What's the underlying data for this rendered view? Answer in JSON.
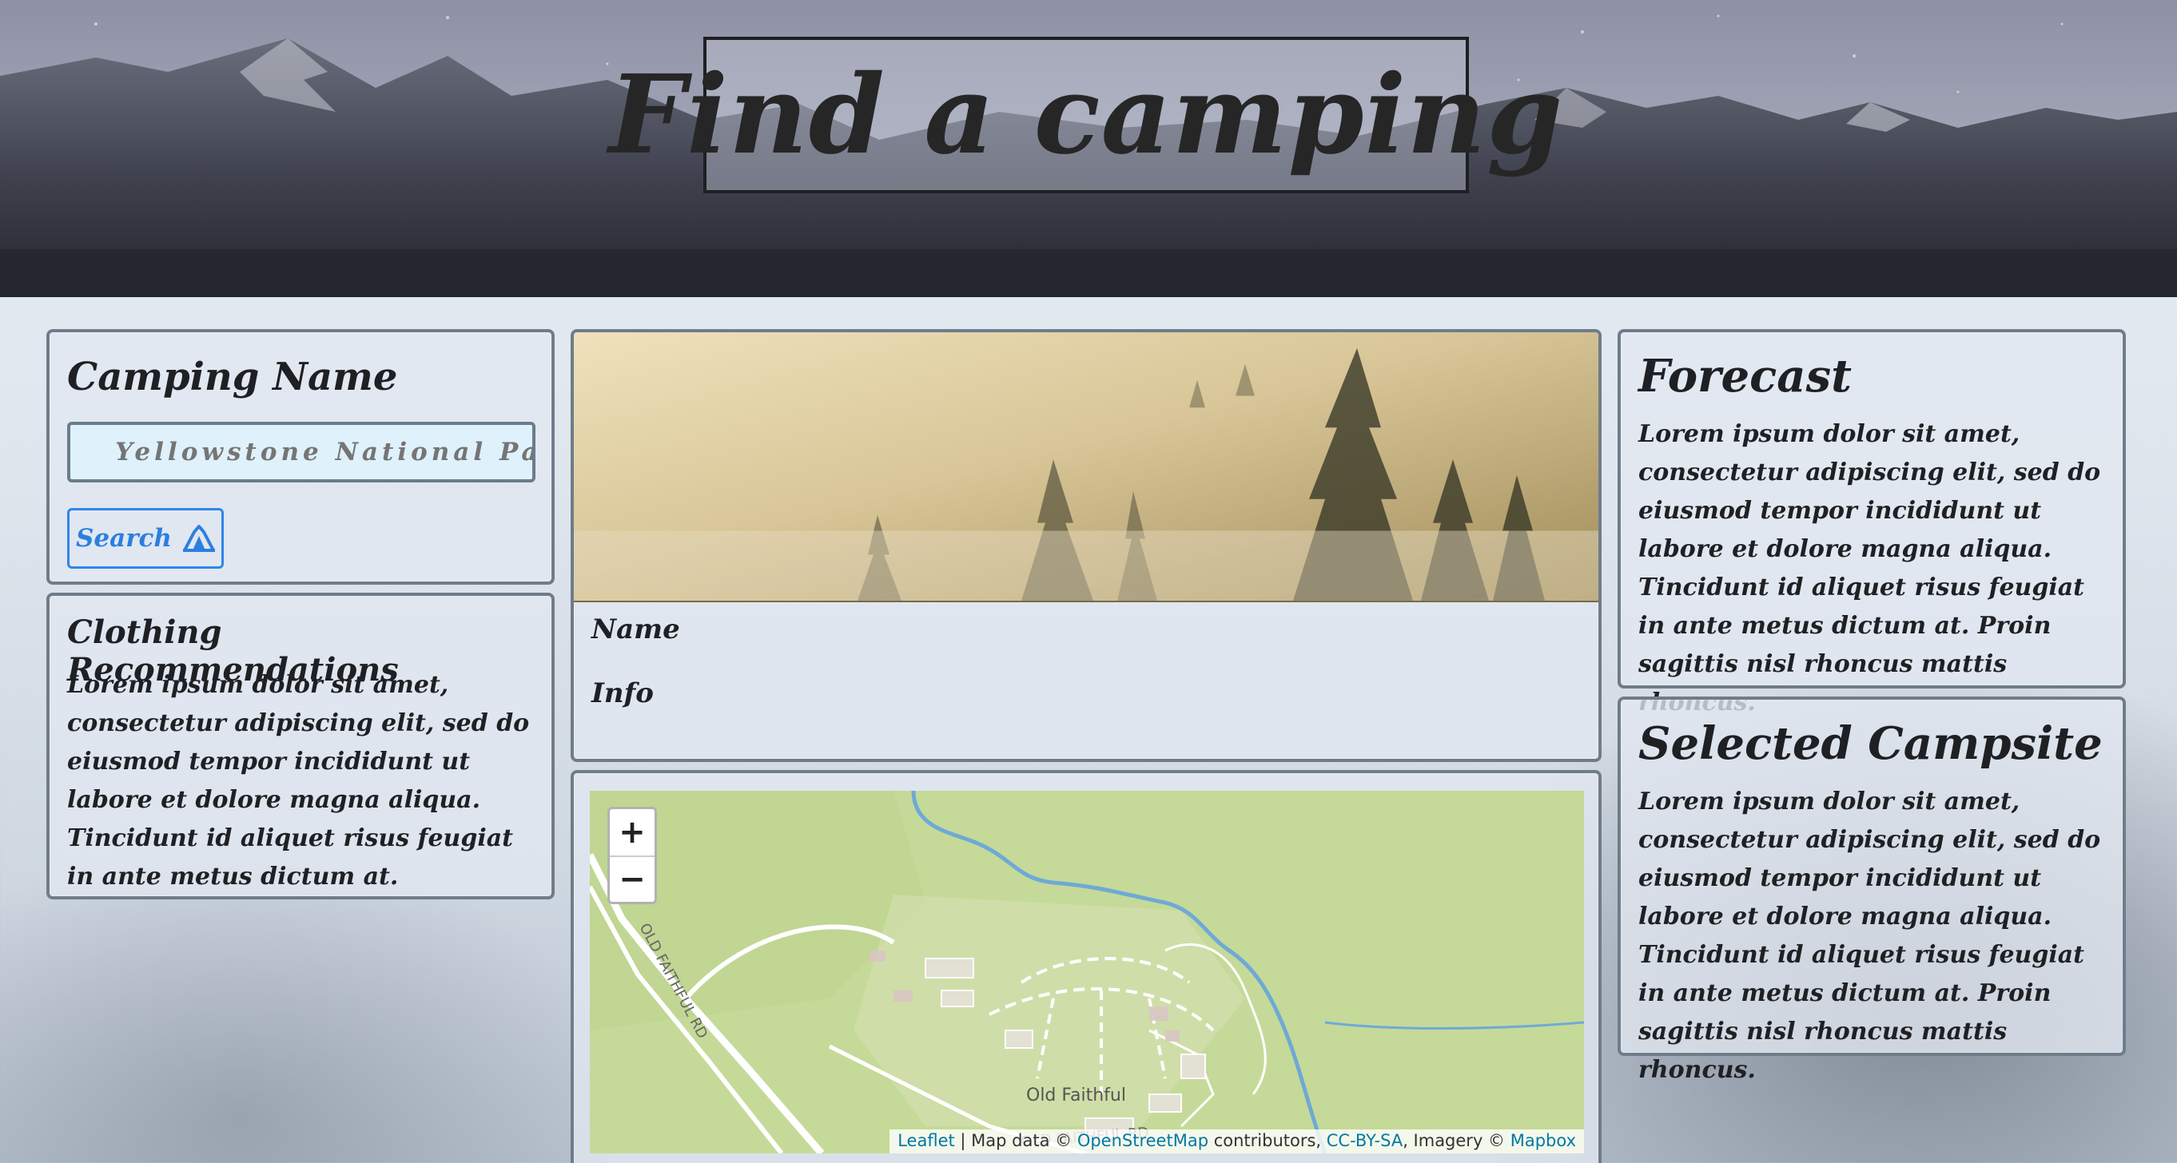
{
  "header": {
    "title": "Find a camping"
  },
  "search": {
    "heading": "Camping Name",
    "placeholder": "Yellowstone National Park",
    "button_label": "Search",
    "button_icon": "tent-icon",
    "accent_color": "#2b7fe0"
  },
  "clothing": {
    "heading": "Clothing Recommendations",
    "text": "Lorem ipsum dolor sit amet, consectetur adipiscing elit, sed do eiusmod tempor incididunt ut labore et dolore magna aliqua. Tincidunt id aliquet risus feugiat in ante metus dictum at."
  },
  "detail": {
    "name_label": "Name",
    "info_label": "Info"
  },
  "map": {
    "zoom_in": "+",
    "zoom_out": "−",
    "labels": {
      "road_1": "OLD FAITHFUL RD",
      "road_2": "OLD FAITHFUL RD",
      "place": "Old Faithful"
    },
    "attribution": {
      "leaflet": "Leaflet",
      "sep1": " | Map data © ",
      "osm": "OpenStreetMap",
      "sep2": " contributors, ",
      "license": "CC-BY-SA",
      "sep3": ", Imagery © ",
      "mapbox": "Mapbox"
    }
  },
  "forecast": {
    "heading": "Forecast",
    "text": "Lorem ipsum dolor sit amet, consectetur adipiscing elit, sed do eiusmod tempor incididunt ut labore et dolore magna aliqua. Tincidunt id aliquet risus feugiat in ante metus dictum at. Proin sagittis nisl rhoncus mattis rhoncus."
  },
  "campsite": {
    "heading": "Selected Campsite",
    "text": "Lorem ipsum dolor sit amet, consectetur adipiscing elit, sed do eiusmod tempor incididunt ut labore et dolore magna aliqua. Tincidunt id aliquet risus feugiat in ante metus dictum at. Proin sagittis nisl rhoncus mattis rhoncus."
  }
}
